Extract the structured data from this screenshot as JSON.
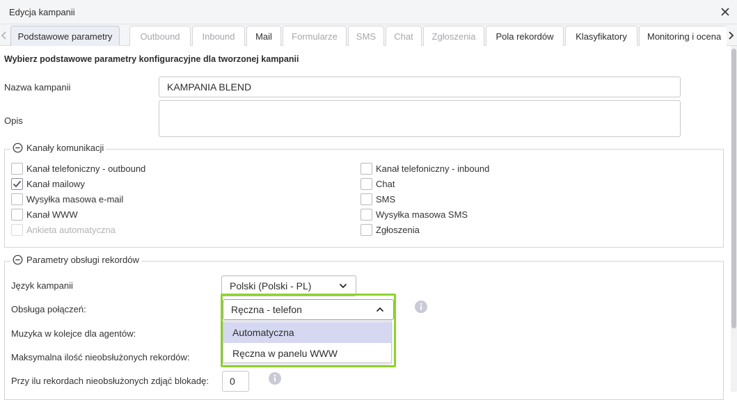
{
  "window": {
    "title": "Edycja kampanii",
    "close_icon": "close-icon"
  },
  "tabs": [
    {
      "label": "Podstawowe parametry",
      "state": "active"
    },
    {
      "label": "Outbound",
      "state": "disabled"
    },
    {
      "label": "Inbound",
      "state": "disabled"
    },
    {
      "label": "Mail",
      "state": "enabled"
    },
    {
      "label": "Formularze",
      "state": "disabled"
    },
    {
      "label": "SMS",
      "state": "disabled"
    },
    {
      "label": "Chat",
      "state": "disabled"
    },
    {
      "label": "Zgłoszenia",
      "state": "disabled"
    },
    {
      "label": "Pola rekordów",
      "state": "enabled"
    },
    {
      "label": "Klasyfikatory",
      "state": "enabled"
    },
    {
      "label": "Monitoring i ocena",
      "state": "enabled"
    }
  ],
  "form": {
    "heading": "Wybierz podstawowe parametry konfiguracyjne dla tworzonej kampanii",
    "name_label": "Nazwa kampanii",
    "name_value": "KAMPANIA BLEND",
    "description_label": "Opis",
    "description_value": ""
  },
  "channels": {
    "legend": "Kanały komunikacji",
    "left": [
      {
        "label": "Kanał telefoniczny - outbound",
        "checked": false,
        "disabled": false
      },
      {
        "label": "Kanał mailowy",
        "checked": true,
        "disabled": false
      },
      {
        "label": "Wysyłka masowa e-mail",
        "checked": false,
        "disabled": false
      },
      {
        "label": "Kanał WWW",
        "checked": false,
        "disabled": false
      },
      {
        "label": "Ankieta automatyczna",
        "checked": false,
        "disabled": true
      }
    ],
    "right": [
      {
        "label": "Kanał telefoniczny - inbound",
        "checked": false,
        "disabled": false
      },
      {
        "label": "Chat",
        "checked": false,
        "disabled": false
      },
      {
        "label": "SMS",
        "checked": false,
        "disabled": false
      },
      {
        "label": "Wysyłka masowa SMS",
        "checked": false,
        "disabled": false
      },
      {
        "label": "Zgłoszenia",
        "checked": false,
        "disabled": false
      }
    ]
  },
  "records": {
    "legend": "Parametry obsługi rekordów",
    "language_label": "Język kampanii",
    "language_value": "Polski (Polski - PL)",
    "call_handling_label": "Obsługa połączeń:",
    "call_handling_value": "Ręczna - telefon",
    "call_handling_options": [
      "Automatyczna",
      "Ręczna w panelu WWW"
    ],
    "call_handling_highlighted_option": "Automatyczna",
    "queue_music_label": "Muzyka w kolejce dla agentów:",
    "max_unhandled_label": "Maksymalna ilość nieobsłużonych rekordów:",
    "unblock_label": "Przy ilu rekordach nieobsłużonych zdjąć blokadę:",
    "unblock_value": "0"
  },
  "colors": {
    "highlight": "#8ed42a",
    "selected_option": "#d6d7f0",
    "checkbox_check": "#5b4a6e"
  }
}
